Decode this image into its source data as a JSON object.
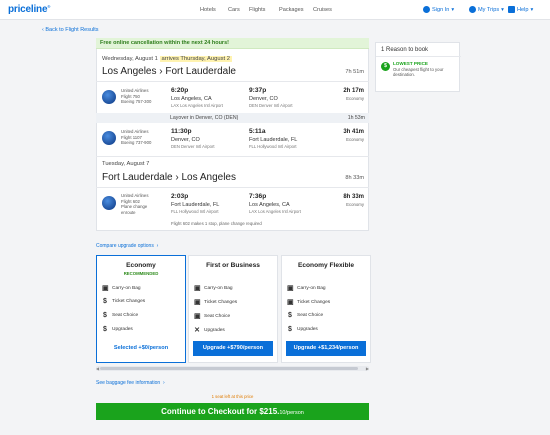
{
  "header": {
    "logo": "priceline",
    "nav": [
      "Hotels",
      "Cars",
      "Flights",
      "Packages",
      "Cruises"
    ],
    "sign_in": "Sign In",
    "my_trips": "My Trips",
    "help": "Help"
  },
  "back_link": "‹ Back to Flight Results",
  "banner": "Free online cancellation within the next 24 hours!",
  "outbound": {
    "date_prefix": "Wednesday, August 1",
    "arrives": "arrives Thursday, August 2",
    "route": "Los Angeles › Fort Lauderdale",
    "duration": "7h 51m",
    "segments": [
      {
        "airline": "United Airlines",
        "flight": "Flight 750",
        "aircraft": "Boeing 757-300",
        "dep_time": "6:20p",
        "dep_city": "Los Angeles, CA",
        "dep_airport": "LAX Los Angeles Intl Airport",
        "arr_time": "9:37p",
        "arr_city": "Denver, CO",
        "arr_airport": "DEN Denver Intl Airport",
        "duration": "2h 17m",
        "cabin": "Economy"
      },
      {
        "airline": "United Airlines",
        "flight": "Flight 1107",
        "aircraft": "Boeing 737-900",
        "dep_time": "11:30p",
        "dep_city": "Denver, CO",
        "dep_airport": "DEN Denver Intl Airport",
        "arr_time": "5:11a",
        "arr_city": "Fort Lauderdale, FL",
        "arr_airport": "FLL Hollywood Intl Airport",
        "duration": "3h 41m",
        "cabin": "Economy"
      }
    ],
    "layover": "Layover in Denver, CO (DEN)",
    "layover_duration": "1h 53m"
  },
  "return": {
    "date": "Tuesday, August 7",
    "route": "Fort Lauderdale › Los Angeles",
    "duration": "8h 33m",
    "segment": {
      "airline": "United Airlines",
      "flight": "Flight 602",
      "aircraft": "Plane change",
      "aircraft2": "enroute",
      "dep_time": "2:03p",
      "dep_city": "Fort Lauderdale, FL",
      "dep_airport": "FLL Hollywood Intl Airport",
      "arr_time": "7:36p",
      "arr_city": "Los Angeles, CA",
      "arr_airport": "LAX Los Angeles Intl Airport",
      "duration": "8h 33m",
      "cabin": "Economy"
    },
    "note": "Flight 602 makes 1 stop, plane change required"
  },
  "compare_link": "Compare upgrade options",
  "fares": [
    {
      "title": "Economy",
      "recommended": "RECOMMENDED",
      "features": [
        {
          "icon": "suitcase-icon",
          "glyph": "▣",
          "label": "Carry-on Bag"
        },
        {
          "icon": "dollar-icon",
          "glyph": "$",
          "label": "Ticket Changes"
        },
        {
          "icon": "dollar-icon",
          "glyph": "$",
          "label": "Seat Choice"
        },
        {
          "icon": "dollar-icon",
          "glyph": "$",
          "label": "Upgrades"
        }
      ],
      "button": "Selected +$0/person"
    },
    {
      "title": "First or Business",
      "features": [
        {
          "icon": "suitcase-icon",
          "glyph": "▣",
          "label": "Carry-on Bag"
        },
        {
          "icon": "suitcase-icon",
          "glyph": "▣",
          "label": "Ticket Changes"
        },
        {
          "icon": "suitcase-icon",
          "glyph": "▣",
          "label": "Seat Choice"
        },
        {
          "icon": "x-icon",
          "glyph": "✕",
          "label": "Upgrades"
        }
      ],
      "button": "Upgrade +$790/person"
    },
    {
      "title": "Economy Flexible",
      "features": [
        {
          "icon": "suitcase-icon",
          "glyph": "▣",
          "label": "Carry-on Bag"
        },
        {
          "icon": "suitcase-icon",
          "glyph": "▣",
          "label": "Ticket Changes"
        },
        {
          "icon": "dollar-icon",
          "glyph": "$",
          "label": "Seat Choice"
        },
        {
          "icon": "dollar-icon",
          "glyph": "$",
          "label": "Upgrades"
        }
      ],
      "button": "Upgrade +$1,234/person"
    }
  ],
  "baggage_link": "See baggage fee information",
  "seats_left": "1 seat left at this price",
  "cta": {
    "label": "Continue to Checkout for $215.",
    "cents": "10/person"
  },
  "sidebar": {
    "title": "1 Reason to book",
    "badge": "$",
    "heading": "LOWEST PRICE",
    "text": "Our cheapest flight to your destination."
  },
  "colors": {
    "accent": "#0a6fd8",
    "green": "#1aa31c",
    "banner_bg": "#e2f4d8"
  }
}
